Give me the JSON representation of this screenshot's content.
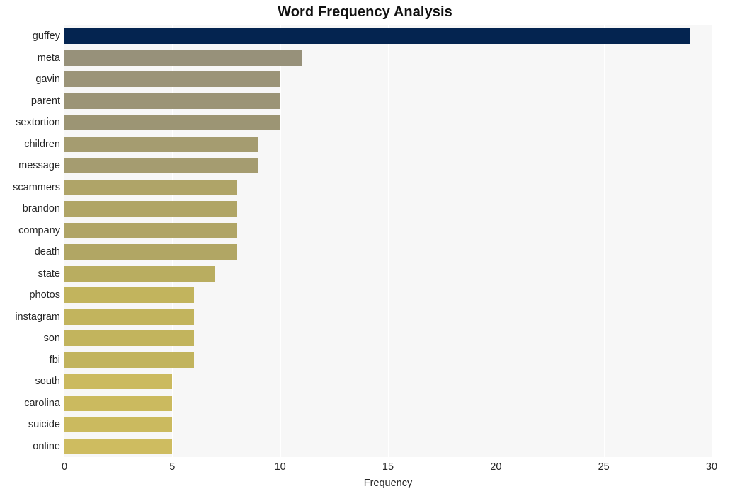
{
  "chart_data": {
    "type": "bar",
    "orientation": "horizontal",
    "title": "Word Frequency Analysis",
    "xlabel": "Frequency",
    "ylabel": "",
    "xlim": [
      0,
      30
    ],
    "xticks": [
      "0",
      "5",
      "10",
      "15",
      "20",
      "25",
      "30"
    ],
    "xtick_values": [
      0,
      5,
      10,
      15,
      20,
      25,
      30
    ],
    "grid": true,
    "grid_axis": "x",
    "legend": "none",
    "categories": [
      "guffey",
      "meta",
      "gavin",
      "parent",
      "sextortion",
      "children",
      "message",
      "scammers",
      "brandon",
      "company",
      "death",
      "state",
      "photos",
      "instagram",
      "son",
      "fbi",
      "south",
      "carolina",
      "suicide",
      "online"
    ],
    "values": [
      29,
      11,
      10,
      10,
      10,
      9,
      9,
      8,
      8,
      8,
      8,
      7,
      6,
      6,
      6,
      6,
      5,
      5,
      5,
      5
    ],
    "bar_colors": [
      "#042450",
      "#97917a",
      "#9b9478",
      "#9b9476",
      "#9c9574",
      "#a59c70",
      "#a59c70",
      "#afa468",
      "#b0a566",
      "#b0a566",
      "#b1a664",
      "#b9ad60",
      "#c2b45d",
      "#c2b45d",
      "#c2b45d",
      "#c2b45d",
      "#cbba5f",
      "#cbba5f",
      "#cbba5f",
      "#cebc60"
    ]
  },
  "style": {
    "plot_background": "#f7f7f7",
    "figure_background": "#ffffff",
    "gridline_color": "#ffffff",
    "text_color": "#262626",
    "title_color": "#111111",
    "highlight_color": "#042450"
  }
}
